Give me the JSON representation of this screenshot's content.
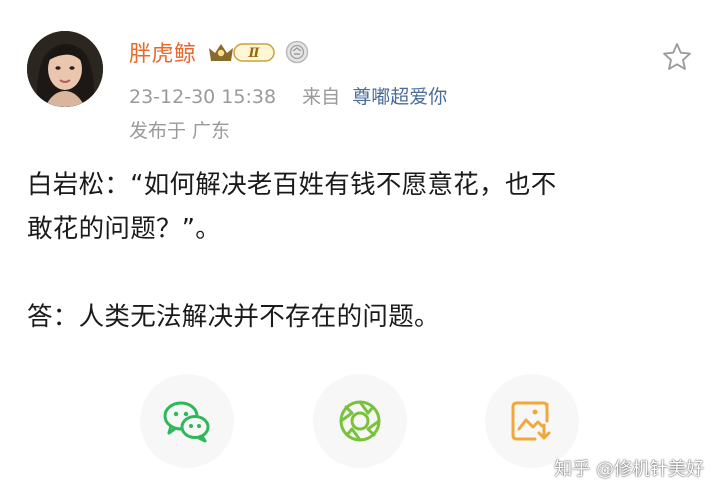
{
  "post": {
    "author": {
      "name": "胖虎鲸",
      "vip_level": "Ⅱ"
    },
    "date": "23-12-30",
    "time": "15:38",
    "source_label": "来自",
    "source_device": "尊嘟超爱你",
    "location": "发布于 广东",
    "content": {
      "line1": "白岩松：“如何解决老百姓有钱不愿意花，也不",
      "line2": "敢花的问题？”。",
      "line3": "答：人类无法解决并不存在的问题。"
    }
  },
  "share_actions": [
    {
      "icon": "wechat-icon"
    },
    {
      "icon": "moments-icon"
    },
    {
      "icon": "save-image-icon"
    }
  ],
  "watermark": "知乎 @修机针美好",
  "colors": {
    "username": "#e8692d",
    "source_link": "#4a6d98",
    "meta_gray": "#9a9a9a",
    "wechat_green": "#2fb85a",
    "moments_green": "#7ac23b",
    "save_orange": "#f0a838"
  }
}
